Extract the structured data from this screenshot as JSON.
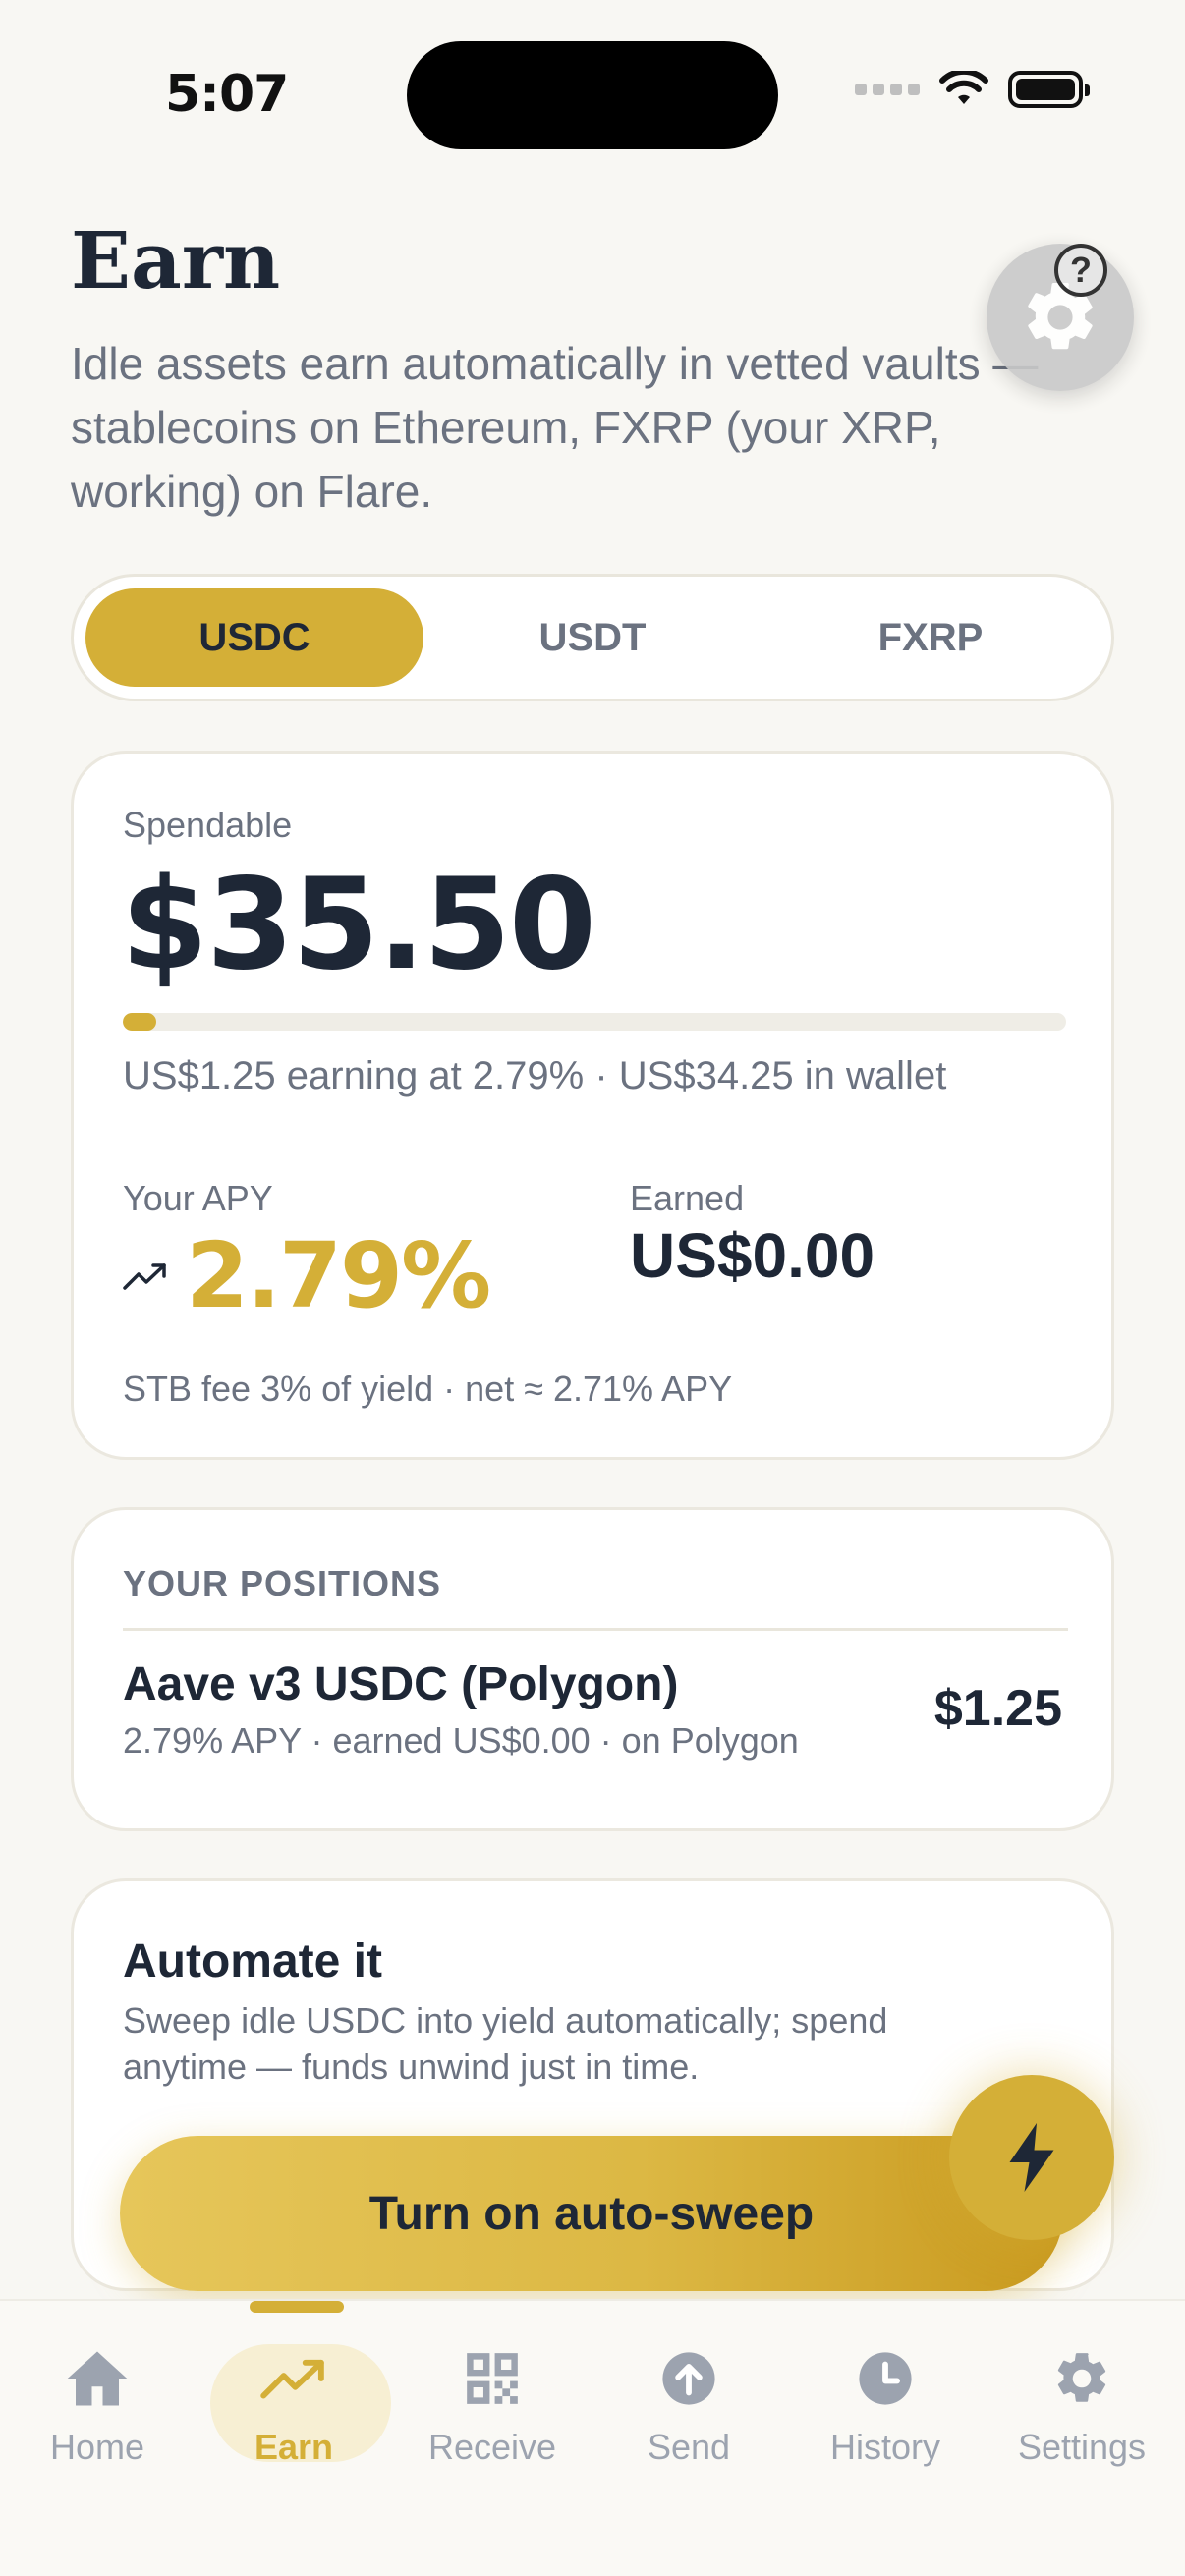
{
  "status_bar": {
    "time": "5:07"
  },
  "header": {
    "title": "Earn",
    "subtitle": "Idle assets earn automatically in vetted vaults — stablecoins on Ethereum, FXRP (your XRP, working) on Flare.",
    "help_glyph": "?"
  },
  "asset_tabs": [
    {
      "label": "USDC",
      "active": true
    },
    {
      "label": "USDT",
      "active": false
    },
    {
      "label": "FXRP",
      "active": false
    }
  ],
  "balance": {
    "spendable_label": "Spendable",
    "spendable_amount": "$35.50",
    "earning_fraction": 0.035,
    "breakdown": "US$1.25 earning at 2.79% · US$34.25 in wallet",
    "apy_label": "Your APY",
    "apy_value": "2.79%",
    "earned_label": "Earned",
    "earned_value": "US$0.00",
    "fee_note": "STB fee 3% of yield · net ≈ 2.71% APY"
  },
  "positions": {
    "section_label": "YOUR POSITIONS",
    "items": [
      {
        "name": "Aave v3 USDC (Polygon)",
        "meta": "2.79% APY · earned US$0.00 · on Polygon",
        "value": "$1.25"
      }
    ]
  },
  "automate": {
    "title": "Automate it",
    "description": "Sweep idle USDC into yield automatically; spend anytime — funds unwind just in time.",
    "cta_label": "Turn on auto-sweep"
  },
  "bottom_nav": [
    {
      "label": "Home",
      "icon": "home-icon",
      "active": false
    },
    {
      "label": "Earn",
      "icon": "trending-up-icon",
      "active": true
    },
    {
      "label": "Receive",
      "icon": "qr-code-icon",
      "active": false
    },
    {
      "label": "Send",
      "icon": "arrow-up-circle-icon",
      "active": false
    },
    {
      "label": "History",
      "icon": "clock-icon",
      "active": false
    },
    {
      "label": "Settings",
      "icon": "gear-icon",
      "active": false
    }
  ],
  "colors": {
    "accent": "#d4af37",
    "text": "#1e2736",
    "muted": "#6b7280",
    "background": "#f8f7f3"
  }
}
